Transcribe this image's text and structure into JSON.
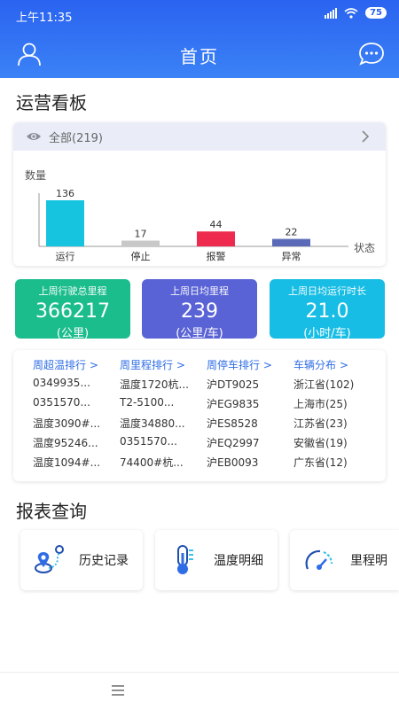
{
  "status_bar": {
    "time": "上午11:35",
    "battery": "75"
  },
  "header": {
    "title": "首页"
  },
  "dashboard": {
    "title": "运营看板",
    "filter": "全部(219)",
    "y_label": "数量",
    "x_label": "状态"
  },
  "chart_data": {
    "type": "bar",
    "categories": [
      "运行",
      "停止",
      "报警",
      "异常"
    ],
    "values": [
      136,
      17,
      44,
      22
    ],
    "colors": [
      "#16c4e0",
      "#c8c8c8",
      "#ee2a4e",
      "#5b6ab8"
    ],
    "ylabel": "数量",
    "xlabel": "状态",
    "ylim": [
      0,
      150
    ]
  },
  "stats": [
    {
      "label": "上周行驶总里程",
      "value": "366217",
      "unit": "(公里)",
      "color": "#1cbd8c"
    },
    {
      "label": "上周日均里程",
      "value": "239",
      "unit": "(公里/车)",
      "color": "#5a63d6"
    },
    {
      "label": "上周日均运行时长",
      "value": "21.0",
      "unit": "(小时/车)",
      "color": "#17bde4"
    }
  ],
  "rankings": [
    {
      "header": "周超温排行 >",
      "items": [
        "0349935...",
        "0351570...",
        "温度3090#...",
        "温度95246...",
        "温度1094#..."
      ]
    },
    {
      "header": "周里程排行 >",
      "items": [
        "温度1720杭...",
        "T2-5100...",
        "温度34880...",
        "0351570...",
        "74400#杭..."
      ]
    },
    {
      "header": "周停车排行 >",
      "items": [
        "沪DT9025",
        "沪EG9835",
        "沪ES8528",
        "沪EQ2997",
        "沪EB0093"
      ]
    },
    {
      "header": "车辆分布 >",
      "items": [
        "浙江省(102)",
        "上海市(25)",
        "江苏省(23)",
        "安徽省(19)",
        "广东省(12)"
      ]
    }
  ],
  "reports": {
    "title": "报表查询",
    "items": [
      {
        "label": "历史记录",
        "icon": "route-map-icon"
      },
      {
        "label": "温度明细",
        "icon": "thermometer-icon"
      },
      {
        "label": "里程明",
        "icon": "speedometer-icon"
      }
    ]
  }
}
